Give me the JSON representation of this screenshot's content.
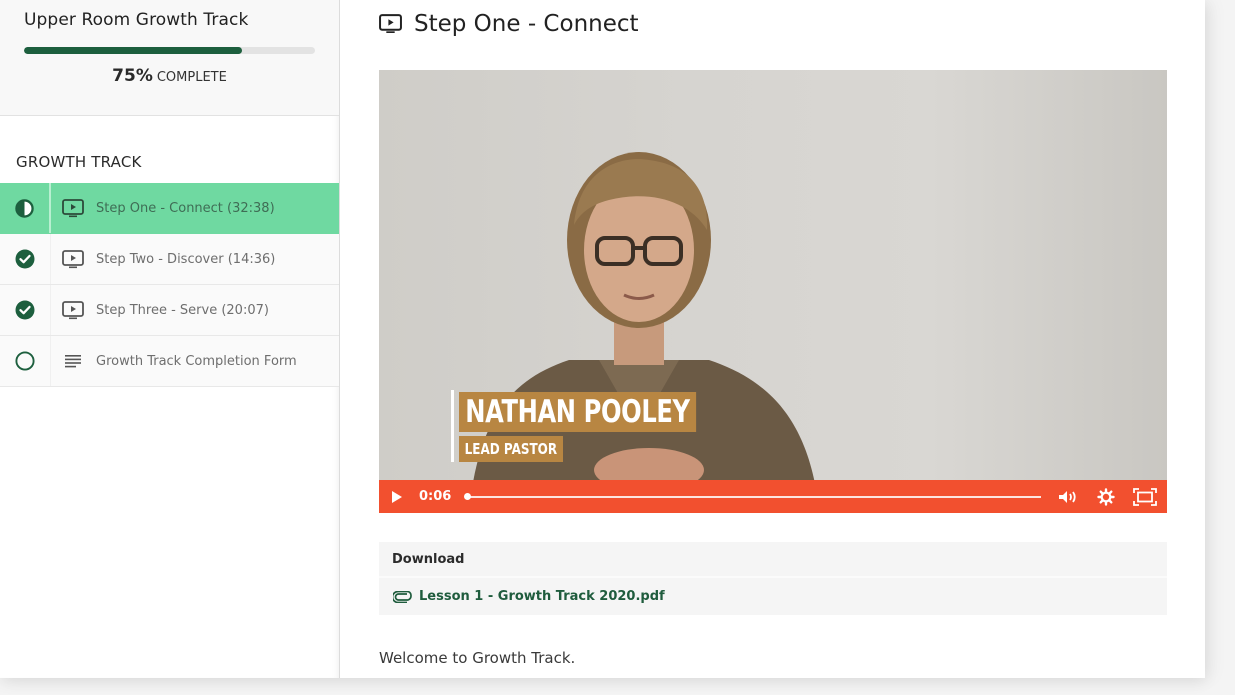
{
  "course": {
    "title": "Upper Room Growth Track",
    "progress_percent": 75,
    "progress_label": "75%",
    "complete_label": "COMPLETE"
  },
  "sidebar": {
    "section_title": "GROWTH TRACK",
    "lessons": [
      {
        "label": "Step One - Connect (32:38)",
        "status": "in-progress",
        "type": "video",
        "active": true
      },
      {
        "label": "Step Two - Discover (14:36)",
        "status": "complete",
        "type": "video",
        "active": false
      },
      {
        "label": "Step Three - Serve (20:07)",
        "status": "complete",
        "type": "video",
        "active": false
      },
      {
        "label": "Growth Track Completion Form",
        "status": "incomplete",
        "type": "text",
        "active": false
      }
    ]
  },
  "main": {
    "title": "Step One - Connect",
    "title_icon": "video-lesson-icon",
    "video": {
      "lower_third_name": "NATHAN POOLEY",
      "lower_third_role": "LEAD PASTOR",
      "current_time": "0:06",
      "played_fraction": 0.0
    },
    "download": {
      "heading": "Download",
      "file_name": "Lesson 1 - Growth Track 2020.pdf",
      "file_icon": "paperclip-icon"
    },
    "body_text": "Welcome to Growth Track."
  },
  "colors": {
    "brand_green": "#1d5f3e",
    "active_lesson": "#6fd9a1",
    "player_accent": "#f2502f",
    "lower_third": "#b88642"
  }
}
